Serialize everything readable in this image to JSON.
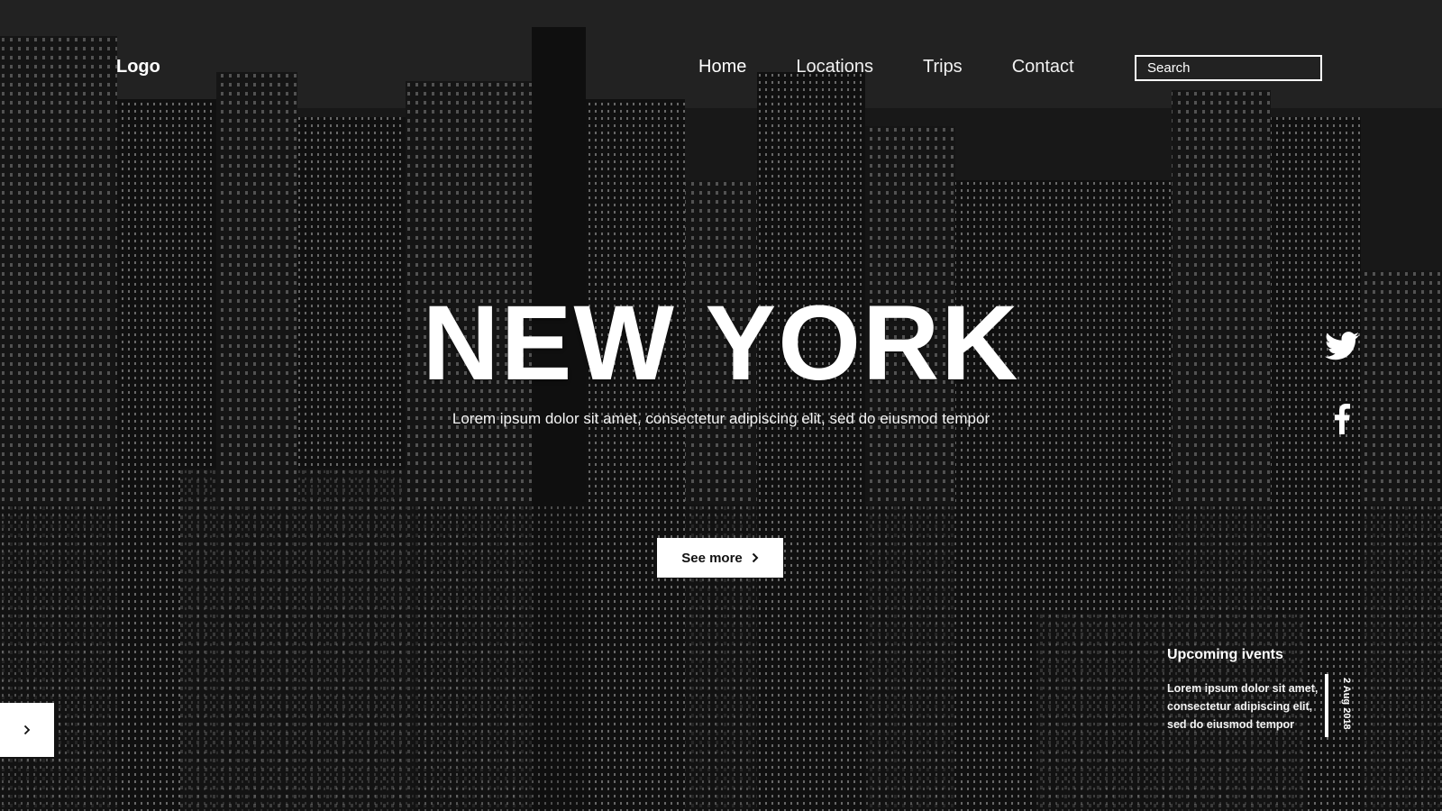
{
  "header": {
    "logo": "Logo",
    "nav": [
      "Home",
      "Locations",
      "Trips",
      "Contact"
    ],
    "active_nav": "Home",
    "search_placeholder": "Search"
  },
  "hero": {
    "title": "NEW YORK",
    "subtitle": "Lorem ipsum dolor sit amet, consectetur adipiscing elit, sed do eiusmod tempor",
    "cta": "See more"
  },
  "events": {
    "title": "Upcoming ivents",
    "text": "Lorem ipsum dolor sit amet, consectetur adipiscing elit, sed do eiusmod tempor",
    "date": "2 Aug 2018"
  },
  "icons": {
    "twitter": "twitter-icon",
    "facebook": "facebook-icon",
    "cta_arrow": "chevron-right-icon",
    "slider_arrow": "chevron-right-icon"
  },
  "colors": {
    "text": "#ffffff",
    "button_bg": "#ffffff",
    "button_text": "#111111"
  }
}
